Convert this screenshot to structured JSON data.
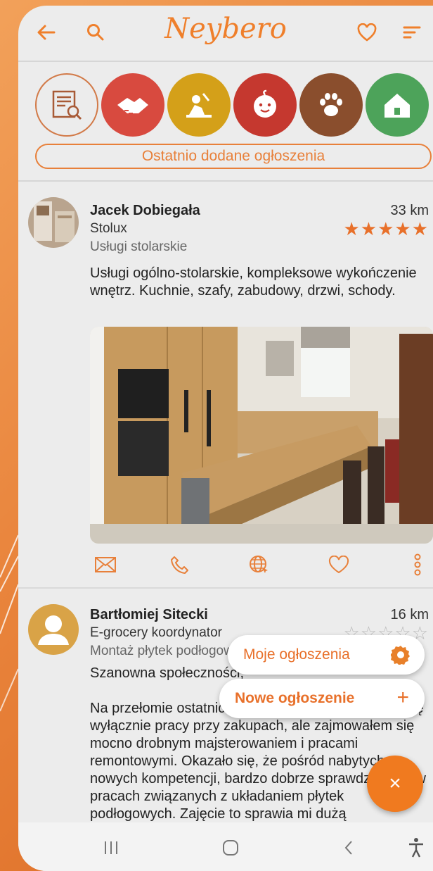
{
  "app": {
    "logo_text": "Neybero",
    "accent": "#ef7f2b"
  },
  "header_icons": [
    "back-arrow-icon",
    "search-icon",
    "heart-icon",
    "sort-menu-icon"
  ],
  "categories": [
    {
      "name": "listings-search",
      "color": "#ececec"
    },
    {
      "name": "handyman-handshake",
      "color": "#d84a3f"
    },
    {
      "name": "cleaning-worker",
      "color": "#d4a019"
    },
    {
      "name": "childcare",
      "color": "#c5382f"
    },
    {
      "name": "pets",
      "color": "#8a4e2d"
    },
    {
      "name": "home",
      "color": "#4da35a"
    }
  ],
  "recent_label": "Ostatnio dodane ogłoszenia",
  "posts": [
    {
      "name": "Jacek Dobiegała",
      "company": "Stolux",
      "category": "Usługi stolarskie",
      "distance": "33 km",
      "rating": 5,
      "description": "Usługi ogólno-stolarskie, kompleksowe wykończenie wnętrz. Kuchnie, szafy, zabudowy, drzwi, schody."
    },
    {
      "name": "Bartłomiej Sitecki",
      "company": "E-grocery koordynator",
      "category": "Montaż płytek podłogowych",
      "distance": "16 km",
      "rating": 0,
      "greeting": "Szanowna społeczności,",
      "description": "Na przełomie ostatnich miesięcy nie ograniczałem się wyłącznie pracy przy zakupach, ale zajmowałem się mocno drobnym majsterowaniem i pracami remontowymi. Okazało się, że pośród nabytych nowych kompetencji, bardzo dobrze sprawdzam się w pracach związanych z układaniem płytek podłogowych. Zajęcie to sprawia mi dużą"
    }
  ],
  "actions": [
    "mail-icon",
    "phone-icon",
    "web-icon",
    "favorite-icon",
    "more-icon"
  ],
  "fab_menu": {
    "my_listings": "Moje ogłoszenia",
    "new_listing": "Nowe ogłoszenie",
    "new_listing_symbol": "+",
    "close_symbol": "×"
  },
  "nav_icons": [
    "recent-apps-icon",
    "home-icon",
    "back-icon",
    "accessibility-icon"
  ]
}
